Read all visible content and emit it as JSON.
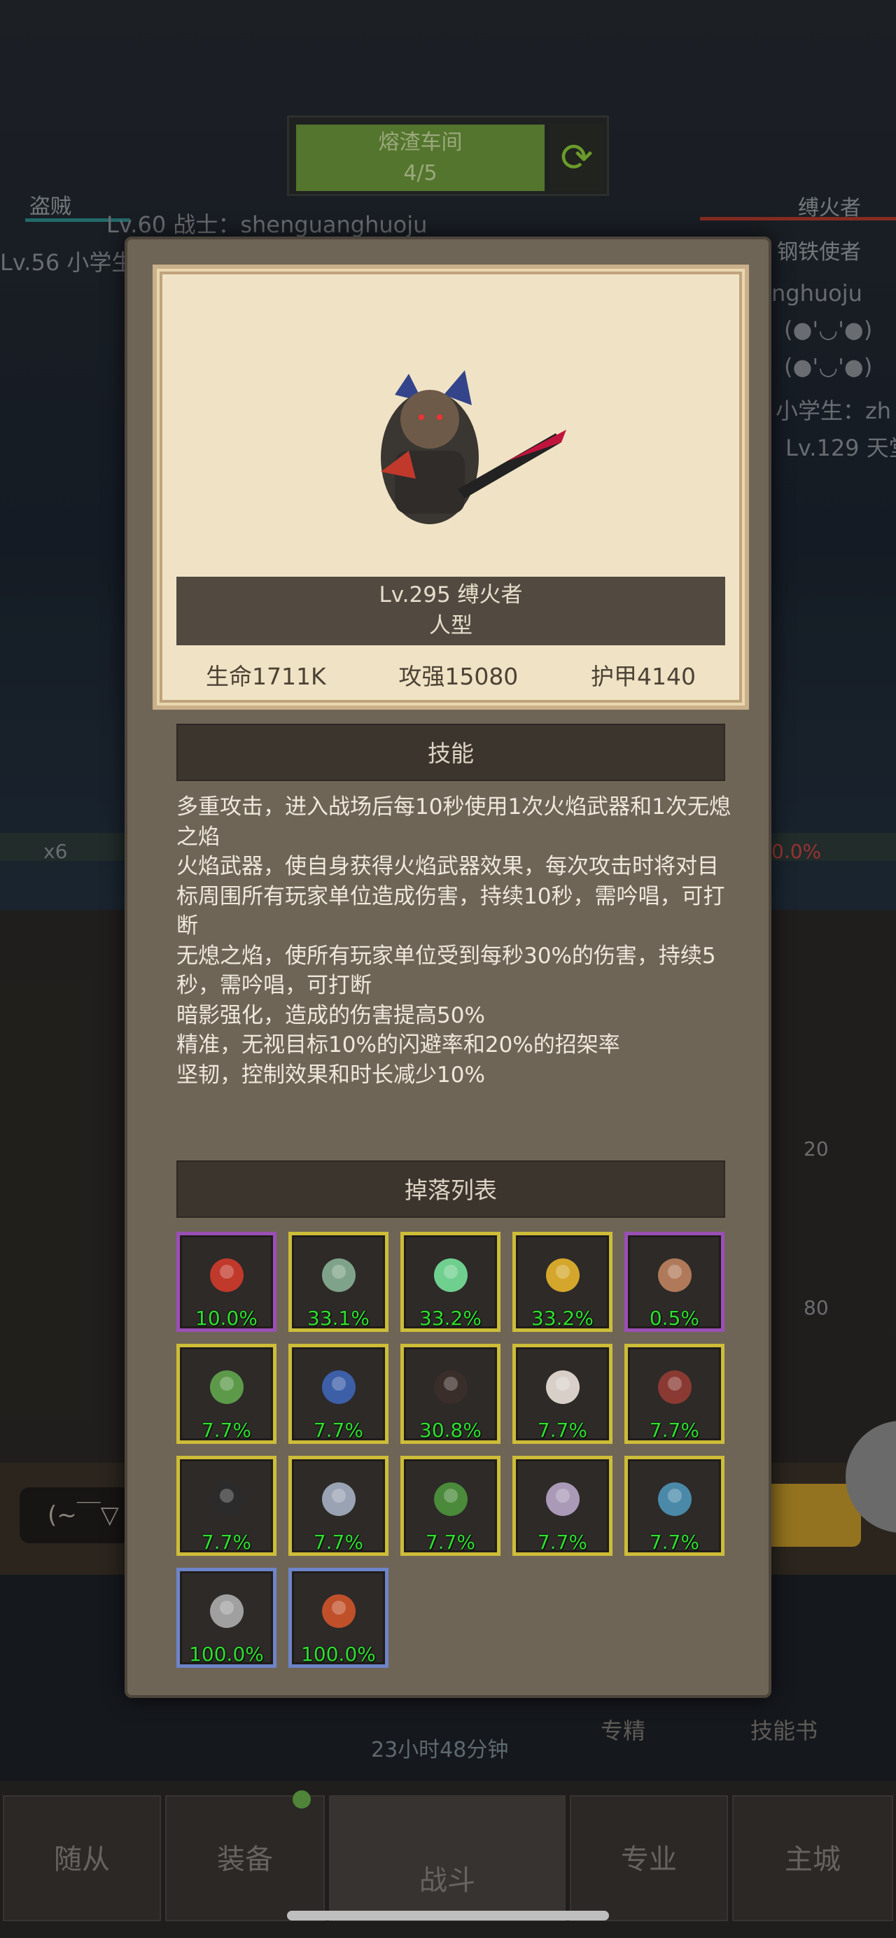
{
  "background": {
    "banner_title": "熔渣车间",
    "banner_progress": "4/5",
    "left_badge": "盗贼",
    "left_line1": "Lv.60 战士：shenguanghuoju",
    "left_line2": "Lv.56 小学生",
    "right_badge1": "缚火者",
    "right_badge2": "钢铁使者",
    "right_text1": "nghuoju",
    "right_text2": "(●'◡'●)",
    "right_text3": "(●'◡'●)",
    "right_text4": "小学生：zh",
    "right_text5": "Lv.129 天堂",
    "mid_left": "x6",
    "mid_right": "0.0%",
    "count_20": "20",
    "count_80": "80",
    "timer": "23小时48分钟",
    "spec_label": "专精",
    "skillbook_label": "技能书",
    "left_input": "(~￣▽"
  },
  "tabs": [
    "随从",
    "装备",
    "战斗",
    "专业",
    "主城"
  ],
  "boss": {
    "level_name": "Lv.295 缚火者",
    "type": "人型",
    "hp": "生命1711K",
    "attack": "攻强15080",
    "armor": "护甲4140"
  },
  "skills_header": "技能",
  "skills": [
    "多重攻击，进入战场后每10秒使用1次火焰武器和1次无熄之焰",
    "火焰武器，使自身获得火焰武器效果，每次攻击时将对目标周围所有玩家单位造成伤害，持续10秒，需吟唱，可打断",
    "无熄之焰，使所有玩家单位受到每秒30%的伤害，持续5秒，需吟唱，可打断",
    "暗影强化，造成的伤害提高50%",
    "精准，无视目标10%的闪避率和20%的招架率",
    "坚韧，控制效果和时长减少10%"
  ],
  "drops_header": "掉落列表",
  "drops": [
    {
      "icon": "ring-icon",
      "pct": "10.0%",
      "rarity": "purple"
    },
    {
      "icon": "helmet-icon",
      "pct": "33.1%",
      "rarity": "gold"
    },
    {
      "icon": "sword-icon",
      "pct": "33.2%",
      "rarity": "gold"
    },
    {
      "icon": "dagger-icon",
      "pct": "33.2%",
      "rarity": "gold"
    },
    {
      "icon": "dwarf-portrait-icon",
      "pct": "0.5%",
      "rarity": "purple"
    },
    {
      "icon": "green-helm-icon",
      "pct": "7.7%",
      "rarity": "gold"
    },
    {
      "icon": "blue-hood-icon",
      "pct": "7.7%",
      "rarity": "gold"
    },
    {
      "icon": "masked-head-icon",
      "pct": "30.8%",
      "rarity": "gold"
    },
    {
      "icon": "white-mask-icon",
      "pct": "7.7%",
      "rarity": "gold"
    },
    {
      "icon": "horned-mask-icon",
      "pct": "7.7%",
      "rarity": "gold"
    },
    {
      "icon": "hood-eyes-icon",
      "pct": "7.7%",
      "rarity": "gold"
    },
    {
      "icon": "steel-helm-icon",
      "pct": "7.7%",
      "rarity": "gold"
    },
    {
      "icon": "demon-head-icon",
      "pct": "7.7%",
      "rarity": "gold"
    },
    {
      "icon": "king-head-icon",
      "pct": "7.7%",
      "rarity": "gold"
    },
    {
      "icon": "lich-head-icon",
      "pct": "7.7%",
      "rarity": "gold"
    },
    {
      "icon": "iron-helm-icon",
      "pct": "100.0%",
      "rarity": "blue"
    },
    {
      "icon": "ember-ore-icon",
      "pct": "100.0%",
      "rarity": "blue"
    }
  ]
}
